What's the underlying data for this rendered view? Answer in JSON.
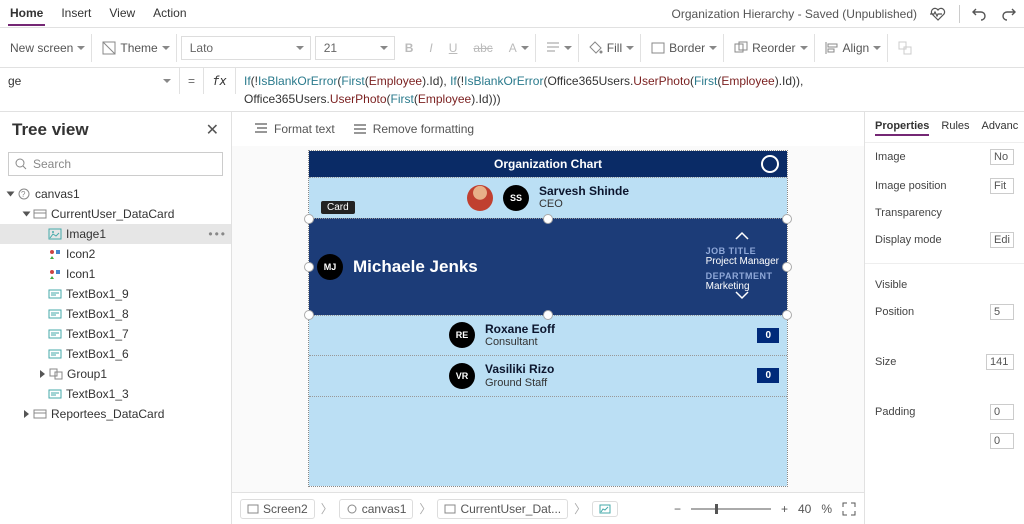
{
  "tabs": {
    "home": "Home",
    "insert": "Insert",
    "view": "View",
    "action": "Action"
  },
  "title": "Organization Hierarchy - Saved (Unpublished)",
  "ribbon": {
    "newscreen": "New screen",
    "theme": "Theme",
    "font": "Lato",
    "size": "21",
    "fill": "Fill",
    "border": "Border",
    "reorder": "Reorder",
    "align": "Align"
  },
  "fx": {
    "prop": "ge",
    "eq": "=",
    "lbl": "fx"
  },
  "formula": {
    "t1": "If",
    "t2": "(!",
    "t3": "IsBlankOrError",
    "t4": "(",
    "t5": "First",
    "t6": "(",
    "t7": "Employee",
    "t8": ").Id), ",
    "t9": "If",
    "t10": "(!",
    "t11": "IsBlankOrError",
    "t12": "(",
    "t13": "Office365Users",
    "t14": ".",
    "t15": "UserPhoto",
    "t16": "(",
    "t17": "First",
    "t18": "(",
    "t19": "Employee",
    "t20": ").Id)),",
    "l2a": "Office365Users",
    "l2b": ".",
    "l2c": "UserPhoto",
    "l2d": "(",
    "l2e": "First",
    "l2f": "(",
    "l2g": "Employee",
    "l2h": ").Id)))"
  },
  "tree": {
    "title": "Tree view",
    "search_ph": "Search",
    "items": {
      "canvas1": "canvas1",
      "currentuser": "CurrentUser_DataCard",
      "image1": "Image1",
      "icon2": "Icon2",
      "icon1": "Icon1",
      "tb19": "TextBox1_9",
      "tb18": "TextBox1_8",
      "tb17": "TextBox1_7",
      "tb16": "TextBox1_6",
      "group1": "Group1",
      "tb13": "TextBox1_3",
      "reportees": "Reportees_DataCard"
    }
  },
  "fmt": {
    "format": "Format text",
    "remove": "Remove formatting"
  },
  "app": {
    "title": "Organization Chart",
    "tag": "Card",
    "ceo": {
      "initials": "SS",
      "name": "Sarvesh Shinde",
      "role": "CEO"
    },
    "current": {
      "initials": "MJ",
      "name": "Michaele Jenks",
      "jt_lbl": "JOB TITLE",
      "jt": "Project Manager",
      "dp_lbl": "DEPARTMENT",
      "dp": "Marketing"
    },
    "r1": {
      "initials": "RE",
      "name": "Roxane Eoff",
      "role": "Consultant",
      "count": "0"
    },
    "r2": {
      "initials": "VR",
      "name": "Vasiliki Rizo",
      "role": "Ground Staff",
      "count": "0"
    }
  },
  "crumbs": {
    "c1": "Screen2",
    "c2": "canvas1",
    "c3": "CurrentUser_Dat...",
    "zoom": "40",
    "pct": "%"
  },
  "props": {
    "tabs": {
      "p": "Properties",
      "r": "Rules",
      "a": "Advanc"
    },
    "image": "Image",
    "image_v": "No",
    "imgpos": "Image position",
    "imgpos_v": "Fit",
    "trans": "Transparency",
    "dmode": "Display mode",
    "dmode_v": "Edi",
    "visible": "Visible",
    "position": "Position",
    "position_v": "5",
    "size": "Size",
    "size_v": "141",
    "padding": "Padding",
    "padding_v": "0",
    "padding_v2": "0"
  }
}
